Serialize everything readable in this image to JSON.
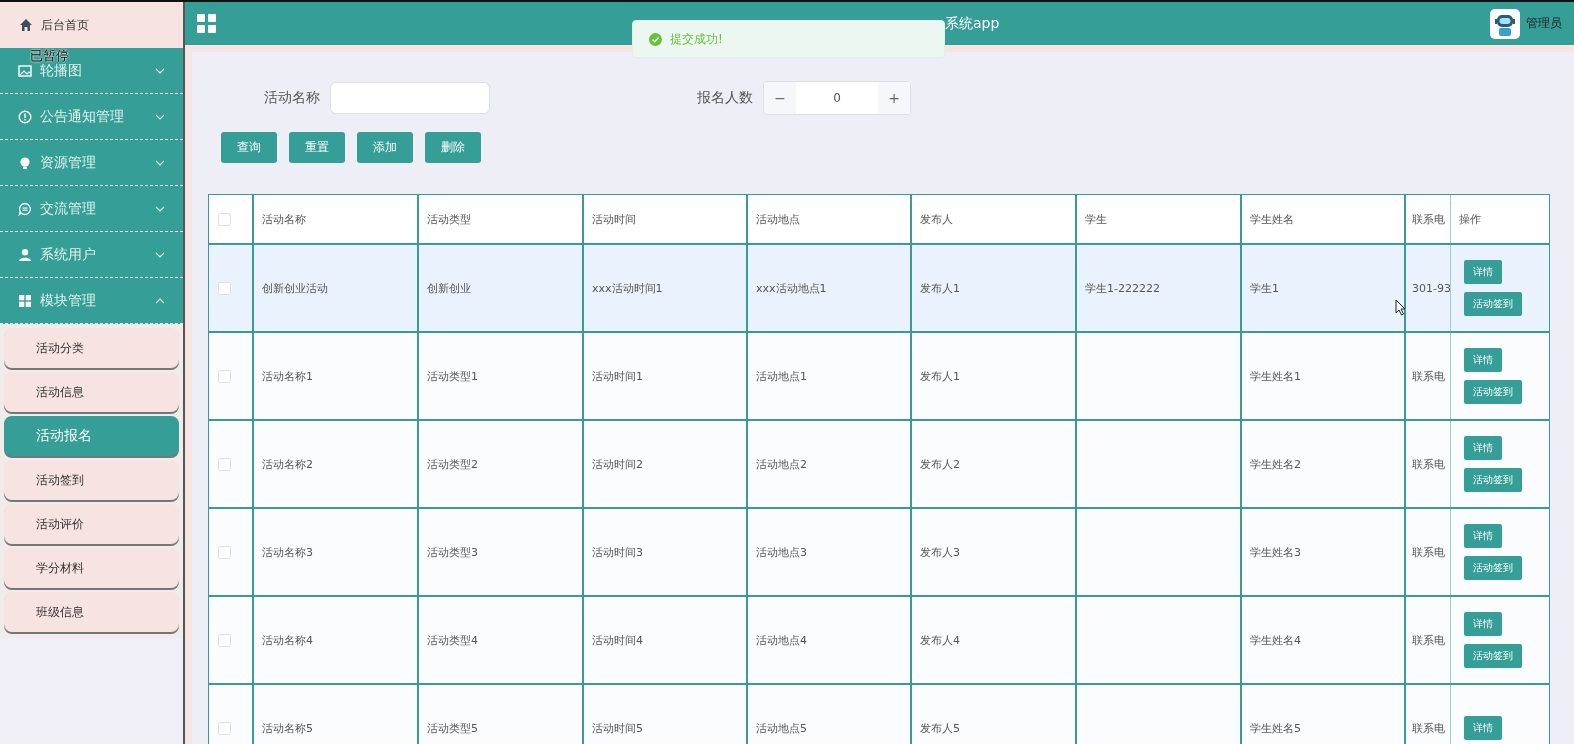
{
  "sidebar": {
    "home": "后台首页",
    "pause_overlay": "已暂停",
    "menus": [
      {
        "label": "轮播图",
        "kind": "image",
        "expanded": false
      },
      {
        "label": "公告通知管理",
        "kind": "info",
        "expanded": false
      },
      {
        "label": "资源管理",
        "kind": "bulb",
        "expanded": false
      },
      {
        "label": "交流管理",
        "kind": "chat",
        "expanded": false
      },
      {
        "label": "系统用户",
        "kind": "user",
        "expanded": false
      },
      {
        "label": "模块管理",
        "kind": "grid",
        "expanded": true,
        "children": [
          {
            "label": "活动分类",
            "selected": false
          },
          {
            "label": "活动信息",
            "selected": false
          },
          {
            "label": "活动报名",
            "selected": true
          },
          {
            "label": "活动签到",
            "selected": false
          },
          {
            "label": "活动评价",
            "selected": false
          },
          {
            "label": "学分材料",
            "selected": false
          },
          {
            "label": "班级信息",
            "selected": false
          }
        ]
      }
    ]
  },
  "header": {
    "title": "系统app",
    "user": "管理员"
  },
  "toast": {
    "message": "提交成功!"
  },
  "search": {
    "fields": [
      {
        "label": "活动名称",
        "kind": "text"
      },
      {
        "label": "报名人数",
        "kind": "number",
        "value": "0",
        "minus": "−",
        "plus": "+"
      }
    ],
    "buttons": [
      "查询",
      "重置",
      "添加",
      "删除"
    ]
  },
  "table": {
    "select_all_checked": false,
    "columns": [
      "活动名称",
      "活动类型",
      "活动时间",
      "活动地点",
      "发布人",
      "学生",
      "学生姓名",
      "联系电",
      "操作"
    ],
    "rows": [
      {
        "cells": [
          "创新创业活动",
          "创新创业",
          "xxx活动时间1",
          "xxx活动地点1",
          "发布人1",
          "学生1-222222",
          "学生1",
          "301-93"
        ],
        "checked": false,
        "highlighted": true,
        "actions": [
          "详情",
          "活动签到"
        ]
      },
      {
        "cells": [
          "活动名称1",
          "活动类型1",
          "活动时间1",
          "活动地点1",
          "发布人1",
          "",
          "学生姓名1",
          "联系电"
        ],
        "checked": false,
        "highlighted": false,
        "actions": [
          "详情",
          "活动签到"
        ]
      },
      {
        "cells": [
          "活动名称2",
          "活动类型2",
          "活动时间2",
          "活动地点2",
          "发布人2",
          "",
          "学生姓名2",
          "联系电"
        ],
        "checked": false,
        "highlighted": false,
        "actions": [
          "详情",
          "活动签到"
        ]
      },
      {
        "cells": [
          "活动名称3",
          "活动类型3",
          "活动时间3",
          "活动地点3",
          "发布人3",
          "",
          "学生姓名3",
          "联系电"
        ],
        "checked": false,
        "highlighted": false,
        "actions": [
          "详情",
          "活动签到"
        ]
      },
      {
        "cells": [
          "活动名称4",
          "活动类型4",
          "活动时间4",
          "活动地点4",
          "发布人4",
          "",
          "学生姓名4",
          "联系电"
        ],
        "checked": false,
        "highlighted": false,
        "actions": [
          "详情",
          "活动签到"
        ]
      },
      {
        "cells": [
          "活动名称5",
          "活动类型5",
          "活动时间5",
          "活动地点5",
          "发布人5",
          "",
          "学生姓名5",
          "联系电"
        ],
        "checked": false,
        "highlighted": false,
        "actions": [
          "详情"
        ]
      }
    ]
  }
}
